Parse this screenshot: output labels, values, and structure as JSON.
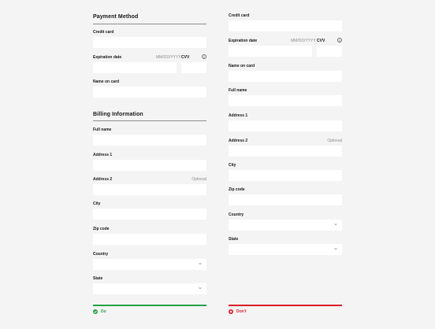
{
  "colors": {
    "do": "#24a148",
    "dont": "#da1e28",
    "background": "#f4f4f4",
    "field": "#ffffff"
  },
  "left": {
    "payment_title": "Payment Method",
    "credit_card_label": "Credit card",
    "expiration_label": "Expiration date",
    "expiration_hint": "MM/DD/YYYY",
    "cvv_label": "CVV",
    "name_on_card_label": "Name on card",
    "billing_title": "Billing Information",
    "full_name_label": "Full name",
    "address1_label": "Address 1",
    "address2_label": "Address 2",
    "address2_hint": "Optional",
    "city_label": "City",
    "zip_label": "Zip code",
    "country_label": "Country",
    "state_label": "State",
    "result_label": "Do",
    "result_icon": "check-circle-icon"
  },
  "right": {
    "credit_card_label": "Credit card",
    "expiration_label": "Expiration date",
    "expiration_hint": "MM/DD/YYYY",
    "cvv_label": "CVV",
    "name_on_card_label": "Name on card",
    "full_name_label": "Full name",
    "address1_label": "Address 1",
    "address2_label": "Address 2",
    "address2_hint": "Optional",
    "city_label": "City",
    "zip_label": "Zip code",
    "country_label": "Country",
    "state_label": "State",
    "result_label": "Don't",
    "result_icon": "x-circle-icon"
  },
  "icons": {
    "info": "info-icon",
    "chevron": "chevron-down-icon"
  }
}
